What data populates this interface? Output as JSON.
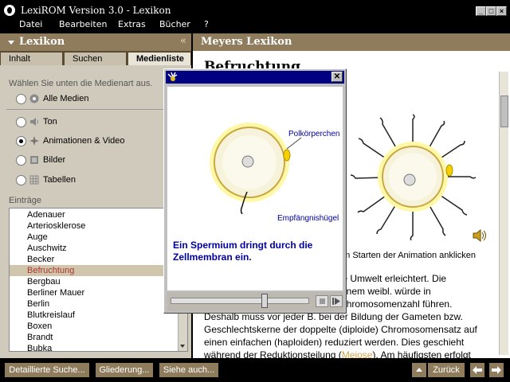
{
  "window": {
    "title": "LexiROM Version 3.0 - Lexikon"
  },
  "menu": [
    "Datei",
    "Bearbeiten",
    "Extras",
    "Bücher",
    "?"
  ],
  "left": {
    "header": "Lexikon",
    "tabs": [
      "Inhalt",
      "Suchen",
      "Medienliste"
    ],
    "instruction": "Wählen Sie unten die Medienart aus.",
    "media_types": [
      {
        "label": "Alle Medien",
        "icon": "all-media-icon",
        "selected": false
      },
      {
        "label": "Ton",
        "icon": "speaker-icon",
        "selected": false
      },
      {
        "label": "Animationen & Video",
        "icon": "animation-icon",
        "selected": true
      },
      {
        "label": "Bilder",
        "icon": "picture-icon",
        "selected": false
      },
      {
        "label": "Tabellen",
        "icon": "table-icon",
        "selected": false
      }
    ],
    "entries_label": "Einträge",
    "entries": [
      "Adenauer",
      "Arteriosklerose",
      "Auge",
      "Auschwitz",
      "Becker",
      "Befruchtung",
      "Bergbau",
      "Berliner Mauer",
      "Berlin",
      "Blutkreislauf",
      "Boxen",
      "Brandt",
      "Bubka"
    ],
    "selected_entry": "Befruchtung"
  },
  "right": {
    "header": "Meyers Lexikon",
    "article_title": "Befruchtung",
    "caption": "um Starten der Animation anklicken",
    "body_lines": [
      "art an die Umwelt erleichtert. Die",
      "rns mit einem weibl. würde in",
      "ing der Chromosomenzahl führen.",
      "Deshalb muss vor jeder B. bei der Bildung der Gameten bzw.",
      "Geschlechtskerne der doppelte (diploide) Chromosomensatz auf",
      "einen einfachen (haploiden) reduziert werden. Dies geschieht"
    ],
    "last_line_before": "während der Reduktionsteilung (",
    "last_line_link": "Meiose",
    "last_line_after": "). Am häufigsten erfolgt"
  },
  "dialog": {
    "label_polar": "Polkörperchen",
    "label_hill": "Empfängnishügel",
    "caption": "Ein Spermium dringt durch die Zellmembran ein.",
    "progress": 0.68
  },
  "bottom": {
    "buttons": [
      "Detaillierte Suche...",
      "Gliederung...",
      "Siehe auch..."
    ],
    "back": "Zurück"
  },
  "colors": {
    "accent": "#8e7c5c",
    "panel": "#cfcabc",
    "selection_text": "#b3352a",
    "link": "#d8a24a",
    "dialog_title": "#000080"
  }
}
